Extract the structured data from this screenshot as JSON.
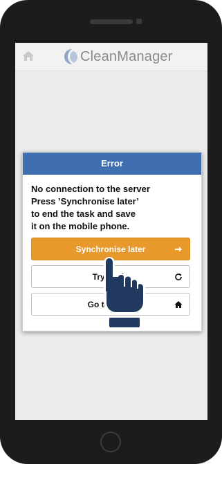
{
  "app": {
    "brand": "CleanManager"
  },
  "dialog": {
    "title": "Error",
    "message_lines": [
      "No connection to the server",
      "Press ’Synchronise later’",
      "to end the task and save",
      "it on the mobile phone."
    ],
    "buttons": {
      "synchronise_later": "Synchronise later",
      "try_again": "Try again",
      "go_to_home": "Go to home"
    }
  },
  "icons": {
    "home": "home-icon",
    "arrow": "arrow-right-icon",
    "refresh": "refresh-icon",
    "hand": "hand-pointer-icon"
  },
  "colors": {
    "header_blue": "#3f6fb1",
    "primary_orange": "#e79a2b",
    "hand_navy": "#22395f",
    "phone_frame": "#1c1c1c"
  }
}
